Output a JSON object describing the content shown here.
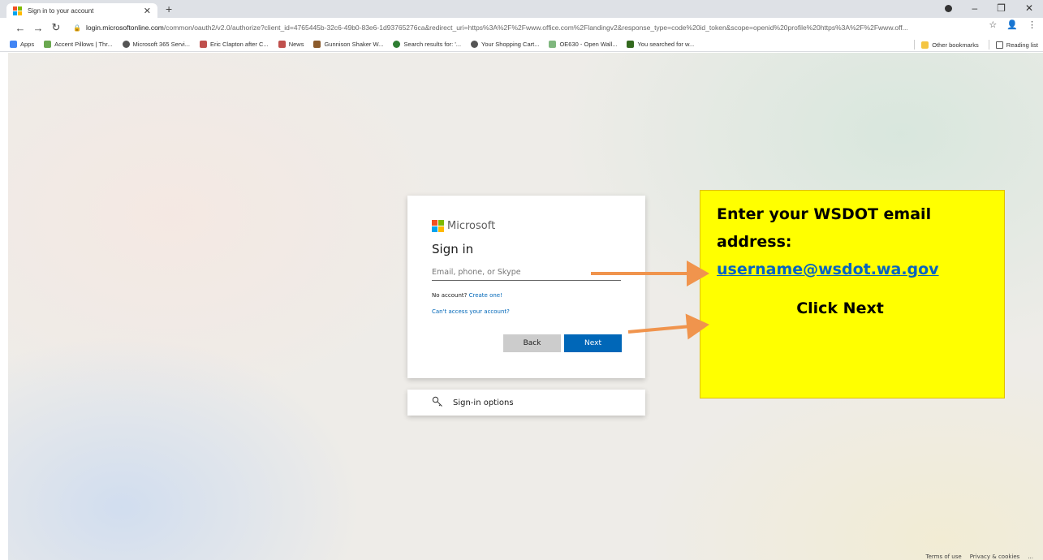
{
  "browser": {
    "tab_title": "Sign in to your account",
    "new_tab_symbol": "+",
    "url_host": "login.microsoftonline.com",
    "url_rest": "/common/oauth2/v2.0/authorize?client_id=4765445b-32c6-49b0-83e6-1d93765276ca&redirect_uri=https%3A%2F%2Fwww.office.com%2Flandingv2&response_type=code%20id_token&scope=openid%20profile%20https%3A%2F%2Fwww.off...",
    "bookmarks": [
      {
        "label": "Apps",
        "color": "#4285f4"
      },
      {
        "label": "Accent Pillows | Thr...",
        "color": "#6aa84f"
      },
      {
        "label": "Microsoft 365 Servi...",
        "color": "#555555"
      },
      {
        "label": "Eric Clapton after C...",
        "color": "#c0504d"
      },
      {
        "label": "News",
        "color": "#c0504d"
      },
      {
        "label": "Gunnison Shaker W...",
        "color": "#8b5a2b"
      },
      {
        "label": "Search results for: '...",
        "color": "#2e7d32"
      },
      {
        "label": "Your Shopping Cart...",
        "color": "#555555"
      },
      {
        "label": "OE630 - Open Wall...",
        "color": "#7fb77e"
      },
      {
        "label": "You searched for w...",
        "color": "#33691e"
      }
    ],
    "other_bookmarks": "Other bookmarks",
    "reading_list": "Reading list"
  },
  "card": {
    "brand": "Microsoft",
    "title": "Sign in",
    "email_placeholder": "Email, phone, or Skype",
    "no_account_text": "No account?",
    "create_link": "Create one!",
    "cant_access": "Can't access your account?",
    "back_label": "Back",
    "next_label": "Next"
  },
  "options": {
    "label": "Sign-in options"
  },
  "callout": {
    "line1": "Enter your WSDOT email",
    "line2": "address:",
    "email": "username@wsdot.wa.gov",
    "click_next": "Click Next"
  },
  "footer": {
    "terms": "Terms of use",
    "privacy": "Privacy & cookies",
    "more": "..."
  },
  "colors": {
    "ms_red": "#f25022",
    "ms_green": "#7fba00",
    "ms_blue": "#00a4ef",
    "ms_yellow": "#ffb900",
    "next_blue": "#0067b8",
    "callout_yellow": "#ffff00",
    "arrow_orange": "#f0944d"
  }
}
